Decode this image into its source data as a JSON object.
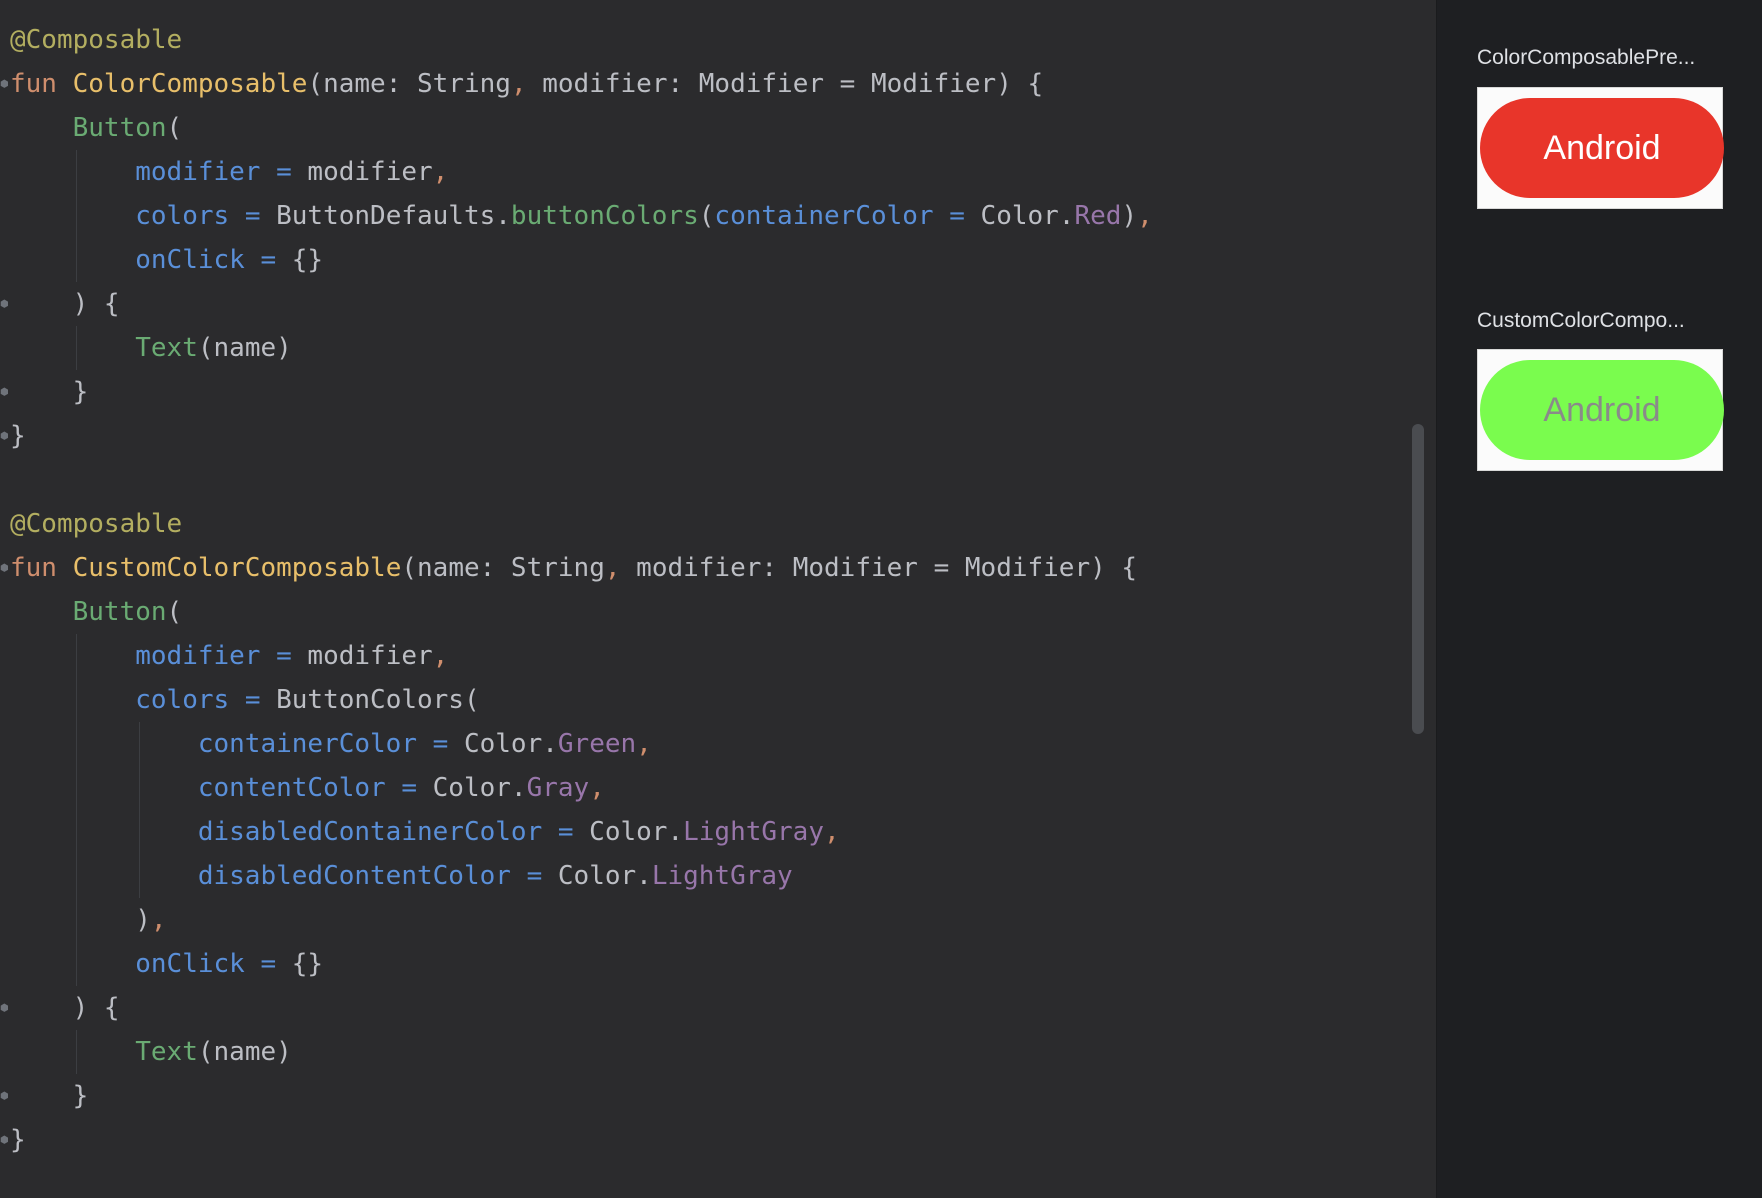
{
  "editor": {
    "lines": [
      {
        "indent": 0,
        "tokens": [
          [
            "anno",
            "@Composable"
          ]
        ]
      },
      {
        "indent": 0,
        "tokens": [
          [
            "kw",
            "fun "
          ],
          [
            "fnd",
            "ColorComposable"
          ],
          [
            "txt",
            "(name: String"
          ],
          [
            "punc",
            ","
          ],
          [
            "txt",
            " modifier: Modifier = Modifier) {"
          ]
        ]
      },
      {
        "indent": 1,
        "tokens": [
          [
            "call",
            "Button"
          ],
          [
            "txt",
            "("
          ]
        ]
      },
      {
        "indent": 2,
        "tokens": [
          [
            "param",
            "modifier"
          ],
          [
            "txt",
            " "
          ],
          [
            "param",
            "="
          ],
          [
            "txt",
            " modifier"
          ],
          [
            "punc",
            ","
          ]
        ]
      },
      {
        "indent": 2,
        "tokens": [
          [
            "param",
            "colors"
          ],
          [
            "txt",
            " "
          ],
          [
            "param",
            "="
          ],
          [
            "txt",
            " ButtonDefaults."
          ],
          [
            "mcall",
            "buttonColors"
          ],
          [
            "txt",
            "("
          ],
          [
            "param",
            "containerColor"
          ],
          [
            "txt",
            " "
          ],
          [
            "param",
            "="
          ],
          [
            "txt",
            " Color."
          ],
          [
            "prop",
            "Red"
          ],
          [
            "txt",
            ")"
          ],
          [
            "punc",
            ","
          ]
        ]
      },
      {
        "indent": 2,
        "tokens": [
          [
            "param",
            "onClick"
          ],
          [
            "txt",
            " "
          ],
          [
            "param",
            "="
          ],
          [
            "txt",
            " {}"
          ]
        ]
      },
      {
        "indent": 1,
        "tokens": [
          [
            "txt",
            ") {"
          ]
        ]
      },
      {
        "indent": 2,
        "tokens": [
          [
            "call",
            "Text"
          ],
          [
            "txt",
            "(name)"
          ]
        ]
      },
      {
        "indent": 1,
        "tokens": [
          [
            "txt",
            "}"
          ]
        ]
      },
      {
        "indent": 0,
        "tokens": [
          [
            "txt",
            "}"
          ]
        ]
      },
      {
        "indent": 0,
        "tokens": []
      },
      {
        "indent": 0,
        "tokens": [
          [
            "anno",
            "@Composable"
          ]
        ]
      },
      {
        "indent": 0,
        "tokens": [
          [
            "kw",
            "fun "
          ],
          [
            "fnd",
            "CustomColorComposable"
          ],
          [
            "txt",
            "(name: String"
          ],
          [
            "punc",
            ","
          ],
          [
            "txt",
            " modifier: Modifier = Modifier) {"
          ]
        ]
      },
      {
        "indent": 1,
        "tokens": [
          [
            "call",
            "Button"
          ],
          [
            "txt",
            "("
          ]
        ]
      },
      {
        "indent": 2,
        "tokens": [
          [
            "param",
            "modifier"
          ],
          [
            "txt",
            " "
          ],
          [
            "param",
            "="
          ],
          [
            "txt",
            " modifier"
          ],
          [
            "punc",
            ","
          ]
        ]
      },
      {
        "indent": 2,
        "tokens": [
          [
            "param",
            "colors"
          ],
          [
            "txt",
            " "
          ],
          [
            "param",
            "="
          ],
          [
            "txt",
            " ButtonColors("
          ]
        ]
      },
      {
        "indent": 3,
        "tokens": [
          [
            "param",
            "containerColor"
          ],
          [
            "txt",
            " "
          ],
          [
            "param",
            "="
          ],
          [
            "txt",
            " Color."
          ],
          [
            "prop",
            "Green"
          ],
          [
            "punc",
            ","
          ]
        ]
      },
      {
        "indent": 3,
        "tokens": [
          [
            "param",
            "contentColor"
          ],
          [
            "txt",
            " "
          ],
          [
            "param",
            "="
          ],
          [
            "txt",
            " Color."
          ],
          [
            "prop",
            "Gray"
          ],
          [
            "punc",
            ","
          ]
        ]
      },
      {
        "indent": 3,
        "tokens": [
          [
            "param",
            "disabledContainerColor"
          ],
          [
            "txt",
            " "
          ],
          [
            "param",
            "="
          ],
          [
            "txt",
            " Color."
          ],
          [
            "prop",
            "LightGray"
          ],
          [
            "punc",
            ","
          ]
        ]
      },
      {
        "indent": 3,
        "tokens": [
          [
            "param",
            "disabledContentColor"
          ],
          [
            "txt",
            " "
          ],
          [
            "param",
            "="
          ],
          [
            "txt",
            " Color."
          ],
          [
            "prop",
            "LightGray"
          ]
        ]
      },
      {
        "indent": 2,
        "tokens": [
          [
            "txt",
            ")"
          ],
          [
            "punc",
            ","
          ]
        ]
      },
      {
        "indent": 2,
        "tokens": [
          [
            "param",
            "onClick"
          ],
          [
            "txt",
            " "
          ],
          [
            "param",
            "="
          ],
          [
            "txt",
            " {}"
          ]
        ]
      },
      {
        "indent": 1,
        "tokens": [
          [
            "txt",
            ") {"
          ]
        ]
      },
      {
        "indent": 2,
        "tokens": [
          [
            "call",
            "Text"
          ],
          [
            "txt",
            "(name)"
          ]
        ]
      },
      {
        "indent": 1,
        "tokens": [
          [
            "txt",
            "}"
          ]
        ]
      },
      {
        "indent": 0,
        "tokens": [
          [
            "txt",
            "}"
          ]
        ]
      }
    ]
  },
  "preview": {
    "items": [
      {
        "title": "ColorComposablePre...",
        "button_label": "Android",
        "bg": "#e8352a",
        "fg": "#ffffff"
      },
      {
        "title": "CustomColorCompo...",
        "button_label": "Android",
        "bg": "#7afc4e",
        "fg": "#8a8a8a"
      }
    ]
  }
}
